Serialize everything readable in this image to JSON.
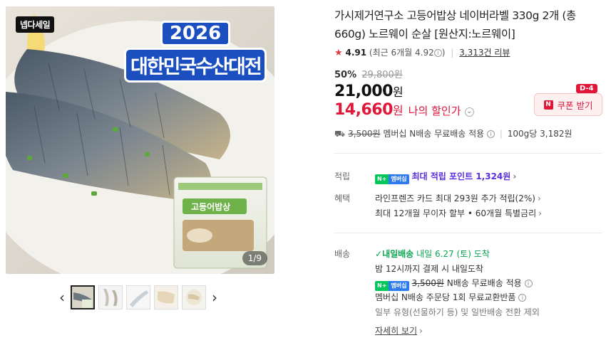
{
  "gallery": {
    "badge": "넵다세일",
    "event_year": "2026",
    "event_name": "대한민국수산대전",
    "package_label": "고등어밥상",
    "counter": "1/9",
    "prev_icon": "chevron-left-icon",
    "next_icon": "chevron-right-icon",
    "thumbnail_count": 5,
    "active_thumbnail": 1
  },
  "product": {
    "title": "가시제거연구소 고등어밥상 네이버라벨 330g 2개 (총 660g) 노르웨이 순살 [원산지:노르웨이]",
    "rating": {
      "star": "★",
      "score": "4.91",
      "recent": "(최근 6개월 4.92",
      "recent_close": ")",
      "reviews": "3,313건 리뷰"
    },
    "discount_rate": "50%",
    "original_price": "29,800원",
    "price": "21,000",
    "price_unit": "원",
    "my_price": "14,660",
    "my_price_unit": "원",
    "my_price_label": "나의 할인가",
    "coupon": {
      "label": "쿠폰 받기",
      "dday": "D-4",
      "n_letter": "N"
    },
    "shipping": {
      "original_fee": "3,500원",
      "text": "멤버십 N배송 무료배송 적용",
      "per_unit": "100g당 3,182원"
    }
  },
  "sections": {
    "earn": {
      "label": "적립",
      "badge_left": "N+",
      "badge_right": "멤버십",
      "text": "최대 적립 포인트",
      "points": "1,324원"
    },
    "benefit": {
      "label": "혜택",
      "line1": "라인프렌즈 카드 최대 293원 추가 적립(2%)",
      "line2": "최대 12개월 무이자 할부 • 60개월 특별금리"
    },
    "delivery": {
      "label": "배송",
      "tomorrow_badge": "내일배송",
      "tomorrow_date": "내일 6.27 (토) 도착",
      "line2": "밤 12시까지 결제 시 내일도착",
      "badge_left": "N+",
      "badge_right": "멤버십",
      "line3_fee": "3,500원",
      "line3_text": "N배송 무료배송 적용",
      "line4": "멤버십 N배송 주문당 1회 무료교환반품",
      "line5": "일부 유형(선물하기 등) 및 일반배송 전환 제외",
      "more": "자세히 보기"
    }
  },
  "colors": {
    "accent_red": "#e1173a",
    "naver_green": "#03c75a",
    "point_purple": "#5a2ee0",
    "event_blue": "#1b4fbf"
  }
}
